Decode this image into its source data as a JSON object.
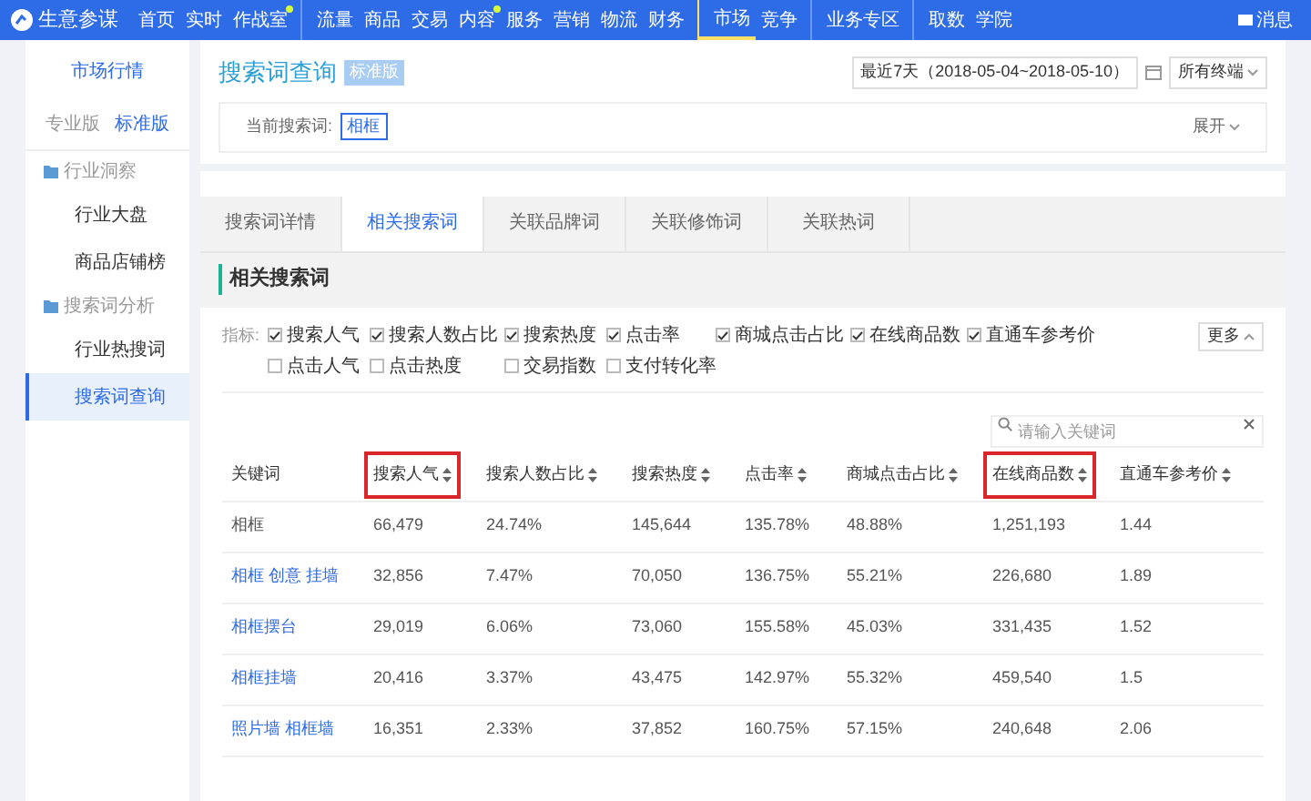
{
  "top_nav": {
    "brand": "生意参谋",
    "items": [
      {
        "label": "首页",
        "selected": false,
        "dot": false
      },
      {
        "label": "实时",
        "selected": false,
        "dot": false
      },
      {
        "label": "作战室",
        "selected": false,
        "dot": true
      },
      {
        "label": "流量",
        "selected": false,
        "dot": false,
        "gap": true
      },
      {
        "label": "商品",
        "selected": false,
        "dot": false
      },
      {
        "label": "交易",
        "selected": false,
        "dot": false
      },
      {
        "label": "内容",
        "selected": false,
        "dot": true
      },
      {
        "label": "服务",
        "selected": false,
        "dot": false
      },
      {
        "label": "营销",
        "selected": false,
        "dot": false
      },
      {
        "label": "物流",
        "selected": false,
        "dot": false
      },
      {
        "label": "财务",
        "selected": false,
        "dot": false
      },
      {
        "label": "市场",
        "selected": true,
        "dot": false,
        "gap": true
      },
      {
        "label": "竞争",
        "selected": false,
        "dot": false
      },
      {
        "label": "业务专区",
        "selected": false,
        "dot": false,
        "gap": true
      },
      {
        "label": "取数",
        "selected": false,
        "dot": false,
        "gap": true
      },
      {
        "label": "学院",
        "selected": false,
        "dot": false
      }
    ],
    "messages": "消息"
  },
  "sidebar": {
    "title": "市场行情",
    "editions": [
      {
        "label": "专业版",
        "selected": false
      },
      {
        "label": "标准版",
        "selected": true
      }
    ],
    "groups": [
      {
        "label": "行业洞察",
        "children": [
          {
            "label": "行业大盘",
            "selected": false
          },
          {
            "label": "商品店铺榜",
            "selected": false
          }
        ]
      },
      {
        "label": "搜索词分析",
        "children": [
          {
            "label": "行业热搜词",
            "selected": false
          },
          {
            "label": "搜索词查询",
            "selected": true
          }
        ]
      }
    ]
  },
  "header": {
    "title": "搜索词查询",
    "badge": "标准版",
    "date_range": "最近7天（2018-05-04~2018-05-10）",
    "terminal": "所有终端",
    "current_label": "当前搜索词:",
    "current_term": "相框",
    "expand": "展开"
  },
  "tabs": [
    {
      "label": "搜索词详情",
      "selected": false
    },
    {
      "label": "相关搜索词",
      "selected": true
    },
    {
      "label": "关联品牌词",
      "selected": false
    },
    {
      "label": "关联修饰词",
      "selected": false
    },
    {
      "label": "关联热词",
      "selected": false
    }
  ],
  "section_title": "相关搜索词",
  "metrics": {
    "label": "指标:",
    "more": "更多",
    "items": [
      {
        "label": "搜索人气",
        "checked": true
      },
      {
        "label": "搜索人数占比",
        "checked": true
      },
      {
        "label": "搜索热度",
        "checked": true
      },
      {
        "label": "点击率",
        "checked": true
      },
      {
        "label": "商城点击占比",
        "checked": true
      },
      {
        "label": "在线商品数",
        "checked": true
      },
      {
        "label": "直通车参考价",
        "checked": true
      },
      {
        "label": "点击人气",
        "checked": false
      },
      {
        "label": "点击热度",
        "checked": false
      },
      {
        "label": "交易指数",
        "checked": false
      },
      {
        "label": "支付转化率",
        "checked": false
      }
    ]
  },
  "search": {
    "placeholder": "请输入关键词"
  },
  "table": {
    "columns": [
      {
        "label": "关键词",
        "sortable": false,
        "highlighted": false
      },
      {
        "label": "搜索人气",
        "sortable": true,
        "highlighted": true
      },
      {
        "label": "搜索人数占比",
        "sortable": true,
        "highlighted": false
      },
      {
        "label": "搜索热度",
        "sortable": true,
        "highlighted": false
      },
      {
        "label": "点击率",
        "sortable": true,
        "highlighted": false
      },
      {
        "label": "商城点击占比",
        "sortable": true,
        "highlighted": false
      },
      {
        "label": "在线商品数",
        "sortable": true,
        "highlighted": true
      },
      {
        "label": "直通车参考价",
        "sortable": true,
        "highlighted": false
      }
    ],
    "rows": [
      {
        "link": false,
        "cells": [
          "相框",
          "66,479",
          "24.74%",
          "145,644",
          "135.78%",
          "48.88%",
          "1,251,193",
          "1.44"
        ]
      },
      {
        "link": true,
        "cells": [
          "相框 创意 挂墙",
          "32,856",
          "7.47%",
          "70,050",
          "136.75%",
          "55.21%",
          "226,680",
          "1.89"
        ]
      },
      {
        "link": true,
        "cells": [
          "相框摆台",
          "29,019",
          "6.06%",
          "73,060",
          "155.58%",
          "45.03%",
          "331,435",
          "1.52"
        ]
      },
      {
        "link": true,
        "cells": [
          "相框挂墙",
          "20,416",
          "3.37%",
          "43,475",
          "142.97%",
          "55.32%",
          "459,540",
          "1.5"
        ]
      },
      {
        "link": true,
        "cells": [
          "照片墙 相框墙",
          "16,351",
          "2.33%",
          "37,852",
          "160.75%",
          "57.15%",
          "240,648",
          "2.06"
        ]
      }
    ]
  }
}
